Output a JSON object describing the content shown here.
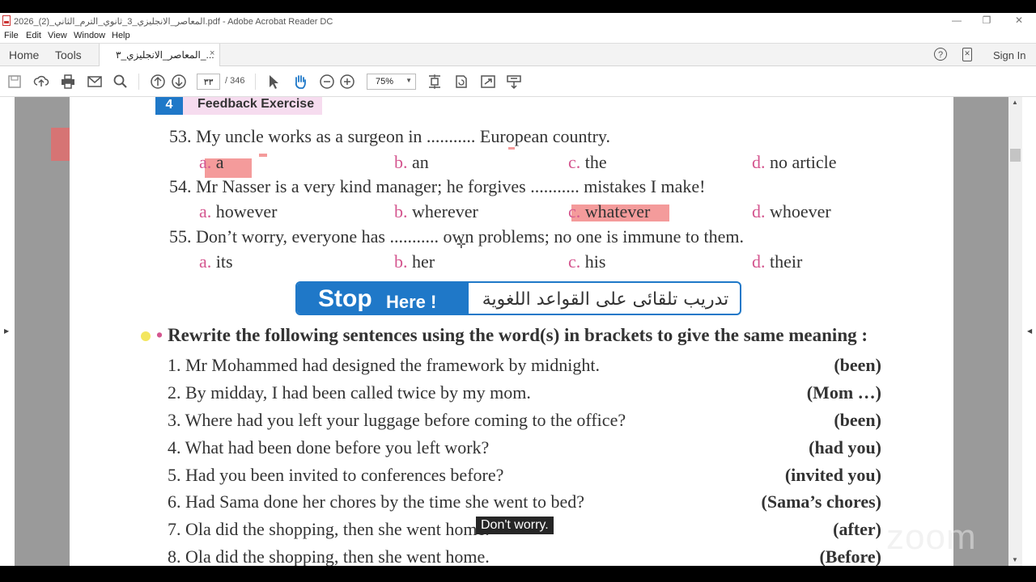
{
  "window": {
    "title": "2026_المعاصر_الانجليزي_3_ثانوي_الترم_الثاني_(2).pdf - Adobe Acrobat Reader DC",
    "minimize": "—",
    "restore": "❐",
    "close": "✕"
  },
  "menu": [
    "File",
    "Edit",
    "View",
    "Window",
    "Help"
  ],
  "tabs": {
    "home": "Home",
    "tools": "Tools",
    "doc_tab": "المعاصر_الانجليزي_٣_...",
    "doc_tab_close": "×",
    "help": "?",
    "signin": "Sign In"
  },
  "toolbar": {
    "page_current": "٣٣",
    "page_total": "/ 346",
    "zoom": "75%",
    "zoom_caret": "▼",
    "icons": [
      "save-icon",
      "upload-icon",
      "print-icon",
      "email-icon",
      "search-icon",
      "prev-page-icon",
      "next-page-icon",
      "select-cursor-icon",
      "hand-tool-icon",
      "zoom-out-icon",
      "zoom-in-icon",
      "page-fit-icon",
      "rotate-icon",
      "fullscreen-icon",
      "read-mode-icon"
    ]
  },
  "document": {
    "section_number": "4",
    "section_title": "Feedback Exercise",
    "questions": [
      {
        "text": "53. My uncle works as a surgeon in ........... European country.",
        "options": [
          {
            "letter": "a.",
            "text": "a"
          },
          {
            "letter": "b.",
            "text": "an"
          },
          {
            "letter": "c.",
            "text": "the"
          },
          {
            "letter": "d.",
            "text": "no article"
          }
        ]
      },
      {
        "text": "54. Mr Nasser is a very kind manager; he forgives ........... mistakes I make!",
        "options": [
          {
            "letter": "a.",
            "text": "however"
          },
          {
            "letter": "b.",
            "text": "wherever"
          },
          {
            "letter": "c.",
            "text": "whatever"
          },
          {
            "letter": "d.",
            "text": "whoever"
          }
        ]
      },
      {
        "text": "55. Don’t worry, everyone has ........... own problems; no one is immune to them.",
        "options": [
          {
            "letter": "a.",
            "text": "its"
          },
          {
            "letter": "b.",
            "text": "her"
          },
          {
            "letter": "c.",
            "text": "his"
          },
          {
            "letter": "d.",
            "text": "their"
          }
        ]
      }
    ],
    "stop_big": "Stop",
    "stop_small": "Here !",
    "stop_arabic": "تدريب تلقائى على القواعد اللغوية",
    "instruction_bullet": "•",
    "instruction": "Rewrite the following sentences using the word(s) in brackets to give the same meaning :",
    "rewrites": [
      {
        "text": "1. Mr Mohammed had designed the framework by midnight.",
        "hint": "(been)"
      },
      {
        "text": "2. By midday, I had been called twice by my mom.",
        "hint": "(Mom …)"
      },
      {
        "text": "3. Where had you left your luggage before coming to the office?",
        "hint": "(been)"
      },
      {
        "text": "4. What had been done before you left work?",
        "hint": "(had you)"
      },
      {
        "text": "5. Had you been invited to conferences before?",
        "hint": "(invited you)"
      },
      {
        "text": "6. Had Sama done her chores by the time she went to bed?",
        "hint": "(Sama’s chores)"
      },
      {
        "text": "7. Ola did the shopping, then she went home.",
        "hint": "(after)"
      },
      {
        "text": "8. Ola did the shopping, then she went home.",
        "hint": "(Before)"
      }
    ]
  },
  "overlay": {
    "caption": "Don't worry.",
    "watermark": "zoom"
  },
  "colors": {
    "highlight": "#f07a7a",
    "option_letter": "#d4568f",
    "section_blue": "#1f78c8",
    "section_pink": "#f6dcef"
  }
}
